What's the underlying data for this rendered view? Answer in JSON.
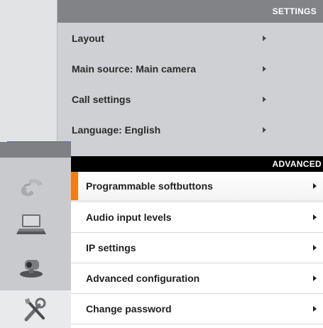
{
  "settings": {
    "header": "SETTINGS",
    "items": [
      {
        "label": "Layout"
      },
      {
        "label": "Main source: Main camera"
      },
      {
        "label": "Call settings"
      },
      {
        "label": "Language: English"
      }
    ]
  },
  "advanced": {
    "header": "ADVANCED",
    "selected_index": 0,
    "items": [
      {
        "label": "Programmable softbuttons"
      },
      {
        "label": "Audio input levels"
      },
      {
        "label": "IP settings"
      },
      {
        "label": "Advanced configuration"
      },
      {
        "label": "Change password"
      }
    ]
  },
  "rail": {
    "icons": [
      "phone-icon",
      "laptop-icon",
      "video-camera-icon",
      "tools-icon"
    ],
    "active_icon": "tools-icon"
  },
  "colors": {
    "selection_accent": "#f07d16",
    "header_dark": "#000000",
    "header_gray": "#818387"
  }
}
